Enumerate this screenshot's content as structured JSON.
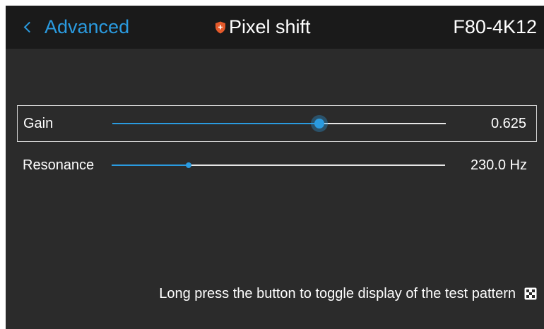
{
  "header": {
    "back_label": "Advanced",
    "title": "Pixel shift",
    "model": "F80-4K12"
  },
  "sliders": [
    {
      "label": "Gain",
      "value": "0.625",
      "fraction": 0.62,
      "selected": true
    },
    {
      "label": "Resonance",
      "value": "230.0 Hz",
      "fraction": 0.23,
      "selected": false
    }
  ],
  "hint": {
    "text": "Long press the button to toggle display of the test pattern",
    "icon": "test-pattern-icon"
  },
  "colors": {
    "accent": "#2a9be0",
    "background": "#2b2b2b",
    "header_background": "#1a1a1a",
    "shield": "#e55a2b"
  }
}
